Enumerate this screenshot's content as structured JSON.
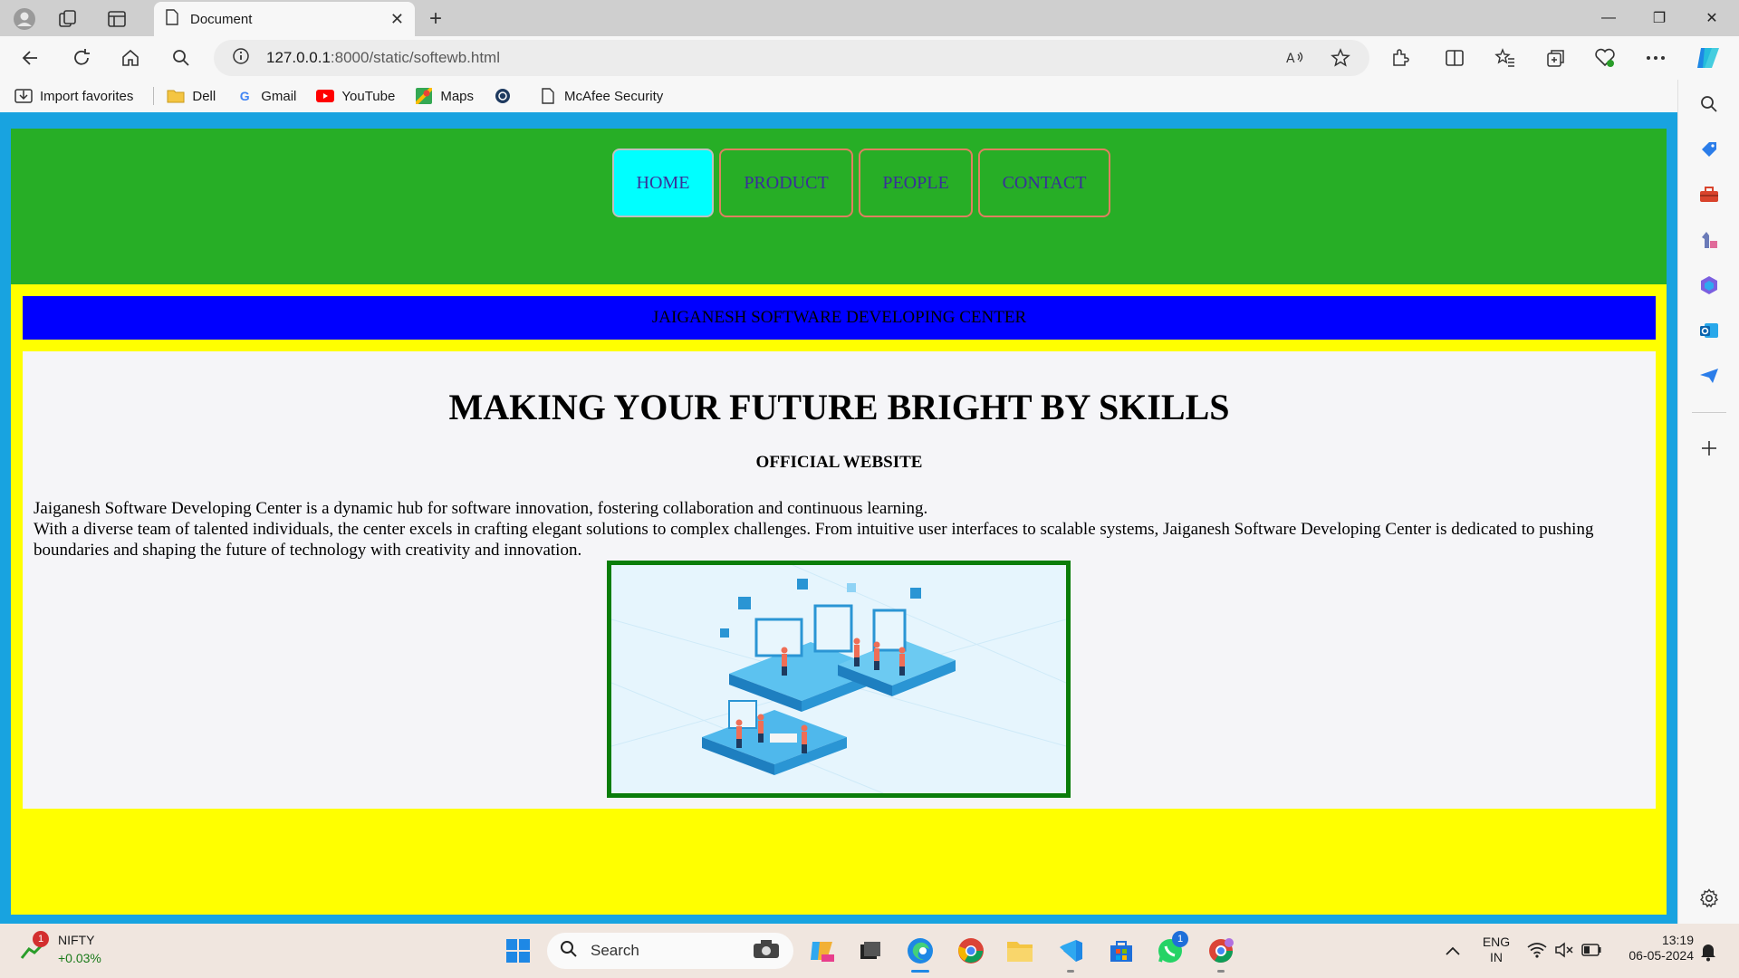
{
  "browser": {
    "tab_title": "Document",
    "tab_close": "✕",
    "new_tab": "+",
    "url_host": "127.0.0.1",
    "url_rest": ":8000/static/softewb.html",
    "window_controls": [
      "—",
      "❐",
      "✕"
    ]
  },
  "favorites": [
    {
      "label": "Import favorites",
      "icon": "import-icon"
    },
    {
      "label": "Dell",
      "icon": "folder-icon"
    },
    {
      "label": "Gmail",
      "icon": "google-icon"
    },
    {
      "label": "YouTube",
      "icon": "youtube-icon"
    },
    {
      "label": "Maps",
      "icon": "maps-icon"
    },
    {
      "label": "",
      "icon": "app-icon"
    },
    {
      "label": "McAfee Security",
      "icon": "page-icon"
    }
  ],
  "site": {
    "menu": [
      "HOME",
      "PRODUCT",
      "PEOPLE",
      "CONTACT"
    ],
    "active_menu": "HOME",
    "banner": "JAIGANESH SOFTWARE DEVELOPING CENTER",
    "heading": "MAKING YOUR FUTURE BRIGHT BY SKILLS",
    "subheading": "OFFICIAL WEBSITE",
    "para1": "Jaiganesh Software Developing Center is a dynamic hub for software innovation, fostering collaboration and continuous learning.",
    "para2": "With a diverse team of talented individuals, the center excels in crafting elegant solutions to complex challenges. From intuitive user interfaces to scalable systems, Jaiganesh Software Developing Center is dedicated to pushing boundaries and shaping the future of technology with creativity and innovation.",
    "colors": {
      "outer": "#18a3e0",
      "header": "#27ae26",
      "yellow": "#ffff00",
      "banner": "#0000ff",
      "active": "#00ffff",
      "image_border": "#0a7d0a"
    }
  },
  "taskbar": {
    "stock_name": "NIFTY",
    "stock_change": "+0.03%",
    "stock_badge": "1",
    "search_placeholder": "Search",
    "whatsapp_badge": "1",
    "lang_top": "ENG",
    "lang_bottom": "IN",
    "time": "13:19",
    "date": "06-05-2024"
  }
}
